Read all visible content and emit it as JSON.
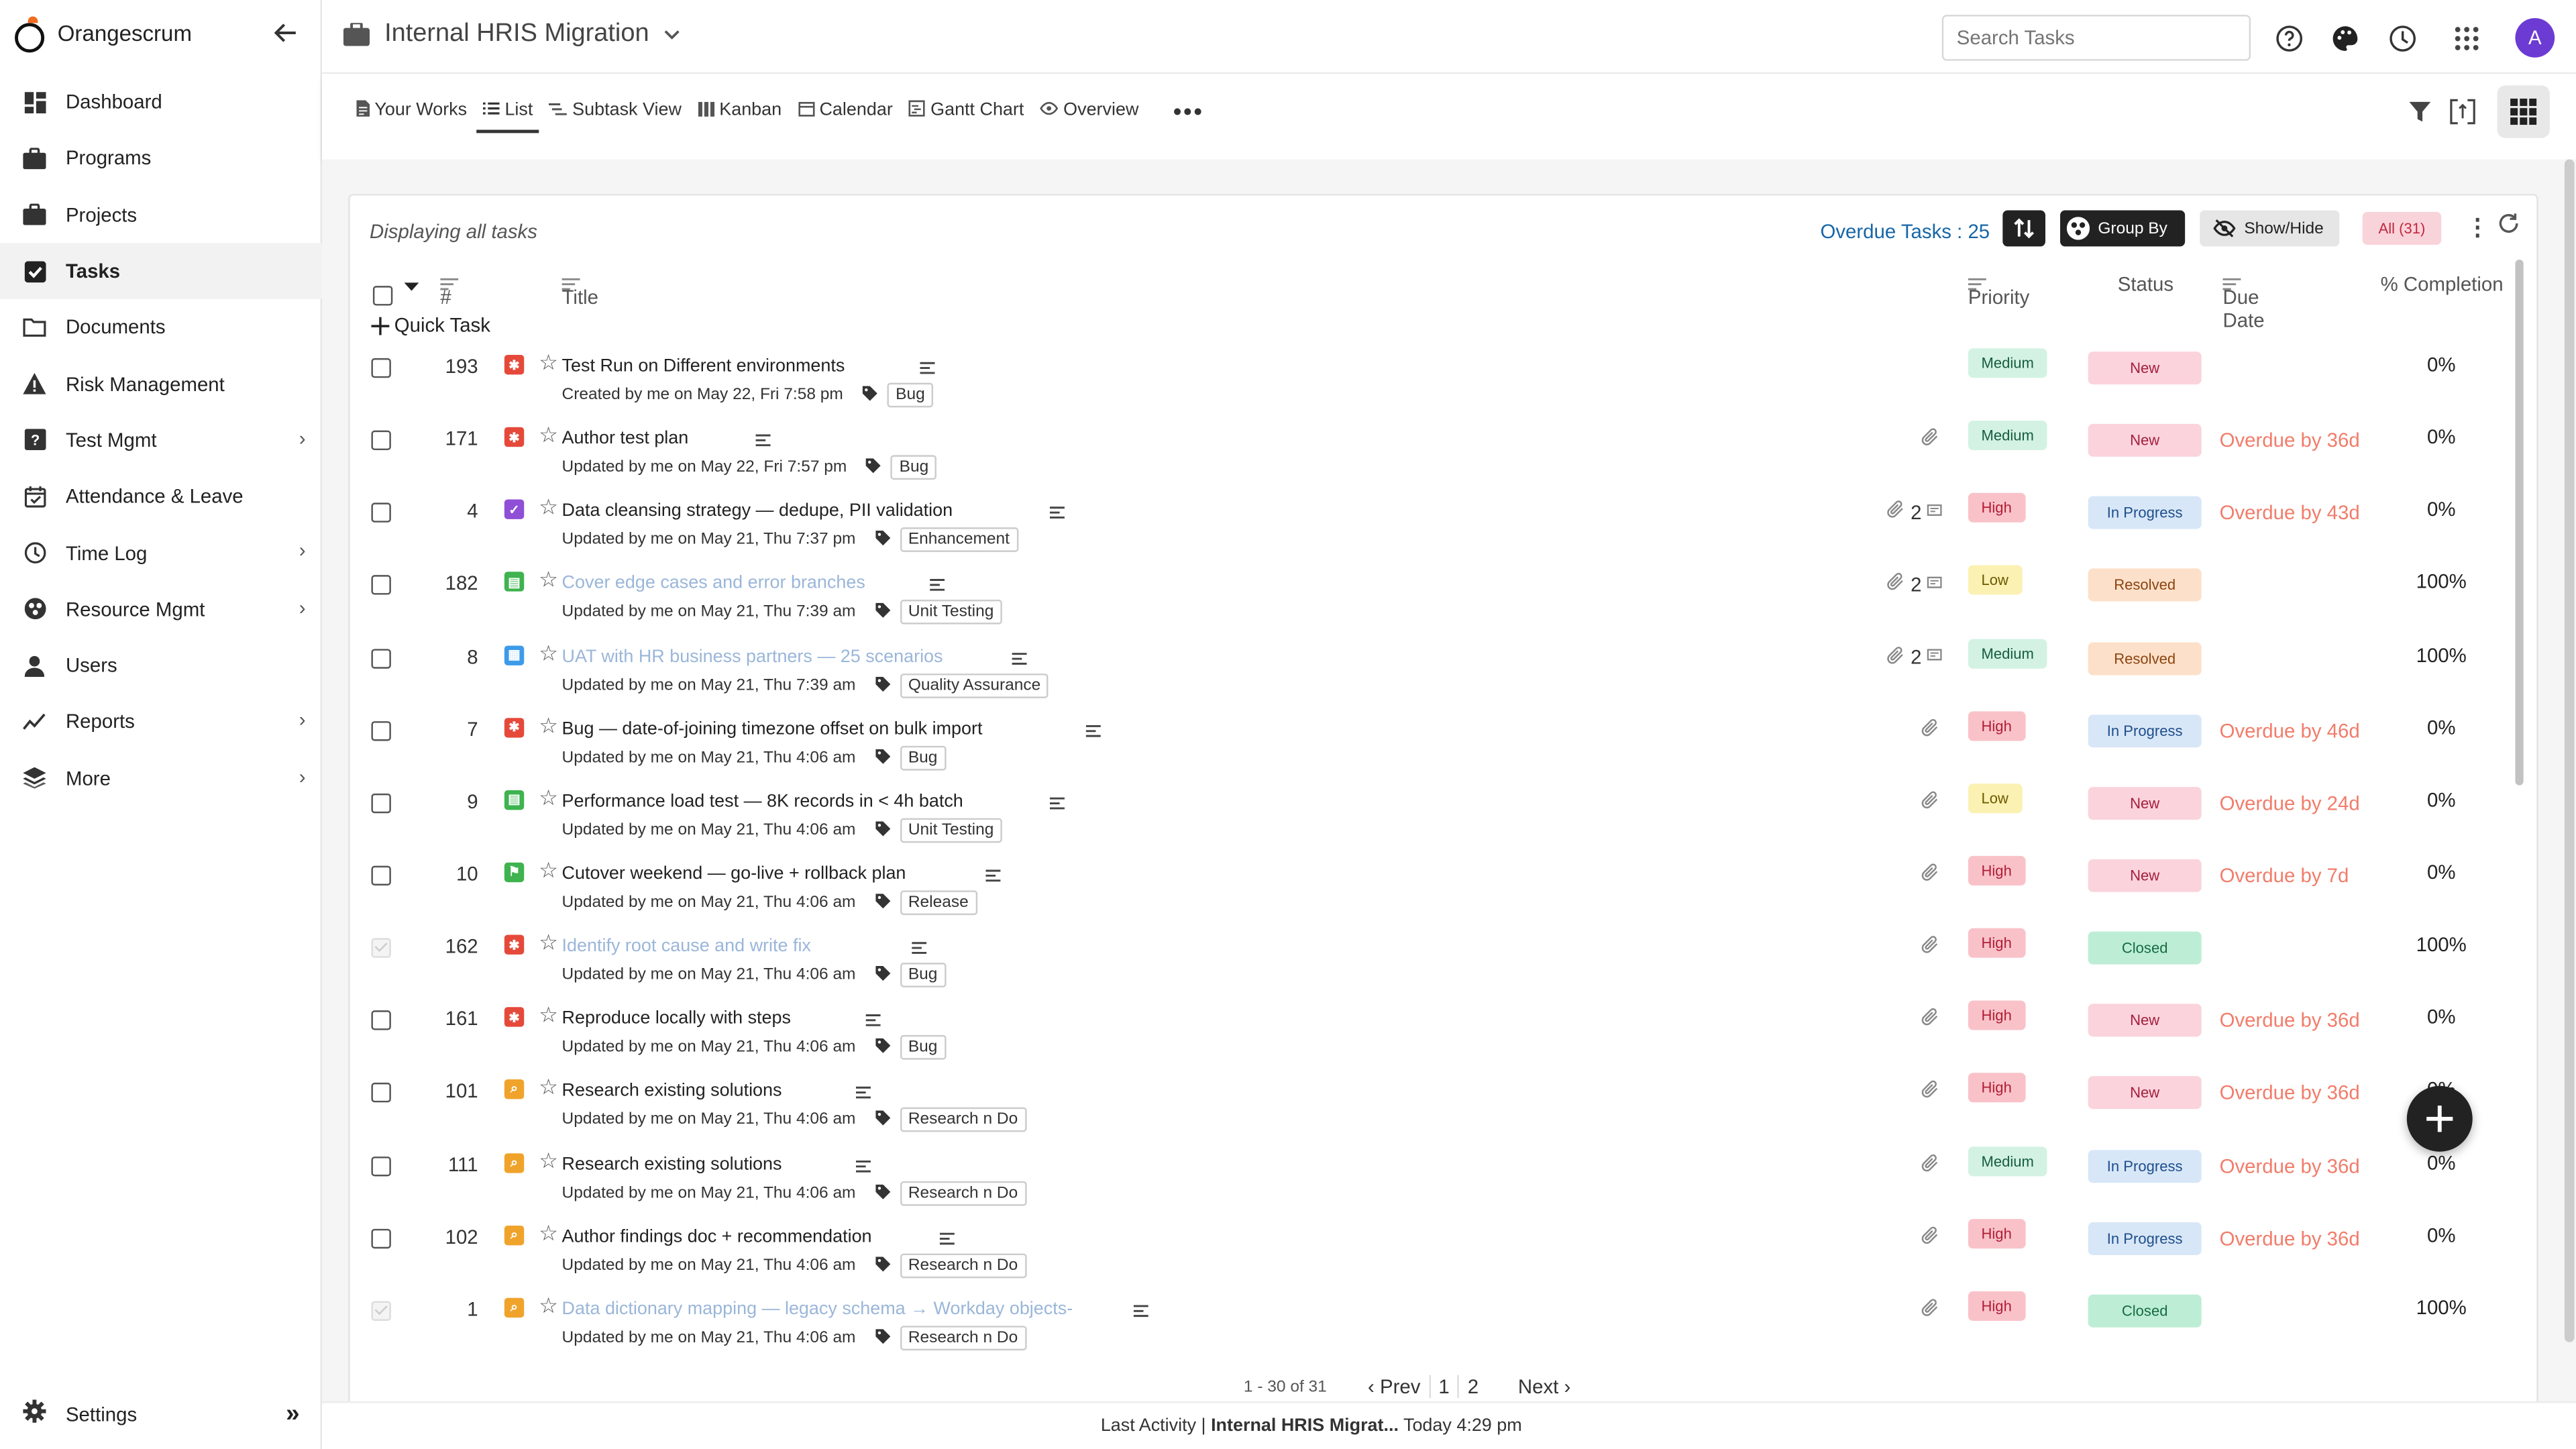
{
  "app": {
    "name": "Orangescrum",
    "logo_icon": "orangescrum-logo",
    "brand_color": "#f26b21"
  },
  "sidebar": {
    "items": [
      {
        "label": "Dashboard",
        "icon": "dashboard-icon",
        "chevron": false
      },
      {
        "label": "Programs",
        "icon": "briefcase-icon",
        "chevron": false
      },
      {
        "label": "Projects",
        "icon": "briefcase-icon",
        "chevron": false
      },
      {
        "label": "Tasks",
        "icon": "task-check-icon",
        "chevron": false,
        "active": true
      },
      {
        "label": "Documents",
        "icon": "folder-icon",
        "chevron": false
      },
      {
        "label": "Risk Management",
        "icon": "warning-icon",
        "chevron": false
      },
      {
        "label": "Test Mgmt",
        "icon": "test-icon",
        "chevron": true
      },
      {
        "label": "Attendance & Leave",
        "icon": "calendar-check-icon",
        "chevron": false
      },
      {
        "label": "Time Log",
        "icon": "clock-icon",
        "chevron": true
      },
      {
        "label": "Resource Mgmt",
        "icon": "resource-icon",
        "chevron": true
      },
      {
        "label": "Users",
        "icon": "user-icon",
        "chevron": false
      },
      {
        "label": "Reports",
        "icon": "chart-line-icon",
        "chevron": true
      },
      {
        "label": "More",
        "icon": "layers-icon",
        "chevron": true
      }
    ],
    "settings_label": "Settings"
  },
  "topbar": {
    "project_name": "Internal HRIS Migration",
    "search_placeholder": "Search Tasks",
    "avatar_initial": "A",
    "avatar_color": "#6c3bd3"
  },
  "views": {
    "tabs": [
      {
        "label": "Your Works",
        "icon": "document-icon"
      },
      {
        "label": "List",
        "icon": "list-icon",
        "active": true
      },
      {
        "label": "Subtask View",
        "icon": "subtask-icon"
      },
      {
        "label": "Kanban",
        "icon": "kanban-icon"
      },
      {
        "label": "Calendar",
        "icon": "calendar-icon"
      },
      {
        "label": "Gantt Chart",
        "icon": "gantt-icon"
      },
      {
        "label": "Overview",
        "icon": "eye-icon"
      }
    ]
  },
  "toolbar": {
    "displaying": "Displaying all tasks",
    "overdue_tasks": "Overdue Tasks : 25",
    "group_by": "Group By",
    "show_hide": "Show/Hide",
    "all_count": "All (31)"
  },
  "table": {
    "headers": {
      "num": "#",
      "title": "Title",
      "priority": "Priority",
      "status": "Status",
      "due_date": "Due Date",
      "completion": "% Completion"
    },
    "quick_task": "Quick Task",
    "rows": [
      {
        "id": "193",
        "type_color": "#e5493a",
        "type_icon": "bug-icon",
        "title": "Test Run on Different environments",
        "meta": "Created by me on May 22, Fri 7:58 pm",
        "tag": "Bug",
        "attach": false,
        "comments": "",
        "priority": "Medium",
        "status": "New",
        "due": "",
        "completion": "0%",
        "muted": false,
        "checked": false
      },
      {
        "id": "171",
        "type_color": "#e5493a",
        "type_icon": "bug-icon",
        "title": "Author test plan",
        "meta": "Updated by me on May 22, Fri 7:57 pm",
        "tag": "Bug",
        "attach": true,
        "comments": "",
        "priority": "Medium",
        "status": "New",
        "due": "Overdue by 36d",
        "completion": "0%",
        "muted": false,
        "checked": false
      },
      {
        "id": "4",
        "type_color": "#8f4fd6",
        "type_icon": "enhancement-icon",
        "title": "Data cleansing strategy — dedupe, PII validation",
        "meta": "Updated by me on May 21, Thu 7:37 pm",
        "tag": "Enhancement",
        "attach": true,
        "comments": "2",
        "priority": "High",
        "status": "In Progress",
        "due": "Overdue by 43d",
        "completion": "0%",
        "muted": false,
        "checked": false
      },
      {
        "id": "182",
        "type_color": "#3eb34f",
        "type_icon": "unit-test-icon",
        "title": "Cover edge cases and error branches",
        "meta": "Updated by me on May 21, Thu 7:39 am",
        "tag": "Unit Testing",
        "attach": true,
        "comments": "2",
        "priority": "Low",
        "status": "Resolved",
        "due": "",
        "completion": "100%",
        "muted": true,
        "checked": false
      },
      {
        "id": "8",
        "type_color": "#3d9be9",
        "type_icon": "qa-icon",
        "title": "UAT with HR business partners — 25 scenarios",
        "meta": "Updated by me on May 21, Thu 7:39 am",
        "tag": "Quality Assurance",
        "attach": true,
        "comments": "2",
        "priority": "Medium",
        "status": "Resolved",
        "due": "",
        "completion": "100%",
        "muted": true,
        "checked": false
      },
      {
        "id": "7",
        "type_color": "#e5493a",
        "type_icon": "bug-icon",
        "title": "Bug — date-of-joining timezone offset on bulk import",
        "meta": "Updated by me on May 21, Thu 4:06 am",
        "tag": "Bug",
        "attach": true,
        "comments": "",
        "priority": "High",
        "status": "In Progress",
        "due": "Overdue by 46d",
        "completion": "0%",
        "muted": false,
        "checked": false
      },
      {
        "id": "9",
        "type_color": "#3eb34f",
        "type_icon": "unit-test-icon",
        "title": "Performance load test — 8K records in < 4h batch",
        "meta": "Updated by me on May 21, Thu 4:06 am",
        "tag": "Unit Testing",
        "attach": true,
        "comments": "",
        "priority": "Low",
        "status": "New",
        "due": "Overdue by 24d",
        "completion": "0%",
        "muted": false,
        "checked": false
      },
      {
        "id": "10",
        "type_color": "#3eb34f",
        "type_icon": "release-icon",
        "title": "Cutover weekend — go-live + rollback plan",
        "meta": "Updated by me on May 21, Thu 4:06 am",
        "tag": "Release",
        "attach": true,
        "comments": "",
        "priority": "High",
        "status": "New",
        "due": "Overdue by 7d",
        "completion": "0%",
        "muted": false,
        "checked": false
      },
      {
        "id": "162",
        "type_color": "#e5493a",
        "type_icon": "bug-icon",
        "title": "Identify root cause and write fix",
        "meta": "Updated by me on May 21, Thu 4:06 am",
        "tag": "Bug",
        "attach": true,
        "comments": "",
        "priority": "High",
        "status": "Closed",
        "due": "",
        "completion": "100%",
        "muted": true,
        "checked": true
      },
      {
        "id": "161",
        "type_color": "#e5493a",
        "type_icon": "bug-icon",
        "title": "Reproduce locally with steps",
        "meta": "Updated by me on May 21, Thu 4:06 am",
        "tag": "Bug",
        "attach": true,
        "comments": "",
        "priority": "High",
        "status": "New",
        "due": "Overdue by 36d",
        "completion": "0%",
        "muted": false,
        "checked": false
      },
      {
        "id": "101",
        "type_color": "#f0a32b",
        "type_icon": "research-icon",
        "title": "Research existing solutions",
        "meta": "Updated by me on May 21, Thu 4:06 am",
        "tag": "Research n Do",
        "attach": true,
        "comments": "",
        "priority": "High",
        "status": "New",
        "due": "Overdue by 36d",
        "completion": "0%",
        "muted": false,
        "checked": false
      },
      {
        "id": "111",
        "type_color": "#f0a32b",
        "type_icon": "research-icon",
        "title": "Research existing solutions",
        "meta": "Updated by me on May 21, Thu 4:06 am",
        "tag": "Research n Do",
        "attach": true,
        "comments": "",
        "priority": "Medium",
        "status": "In Progress",
        "due": "Overdue by 36d",
        "completion": "0%",
        "muted": false,
        "checked": false
      },
      {
        "id": "102",
        "type_color": "#f0a32b",
        "type_icon": "research-icon",
        "title": "Author findings doc + recommendation",
        "meta": "Updated by me on May 21, Thu 4:06 am",
        "tag": "Research n Do",
        "attach": true,
        "comments": "",
        "priority": "High",
        "status": "In Progress",
        "due": "Overdue by 36d",
        "completion": "0%",
        "muted": false,
        "checked": false
      },
      {
        "id": "1",
        "type_color": "#f0a32b",
        "type_icon": "research-icon",
        "title": "Data dictionary mapping — legacy schema → Workday objects-",
        "meta": "Updated by me on May 21, Thu 4:06 am",
        "tag": "Research n Do",
        "attach": true,
        "comments": "",
        "priority": "High",
        "status": "Closed",
        "due": "",
        "completion": "100%",
        "muted": true,
        "checked": true
      }
    ]
  },
  "pager": {
    "range": "1 - 30 of 31",
    "prev": "Prev",
    "pages": [
      "1",
      "2"
    ],
    "next": "Next"
  },
  "footer": {
    "prefix": "Last Activity |",
    "project": "Internal HRIS Migrat...",
    "time": "Today 4:29 pm"
  }
}
